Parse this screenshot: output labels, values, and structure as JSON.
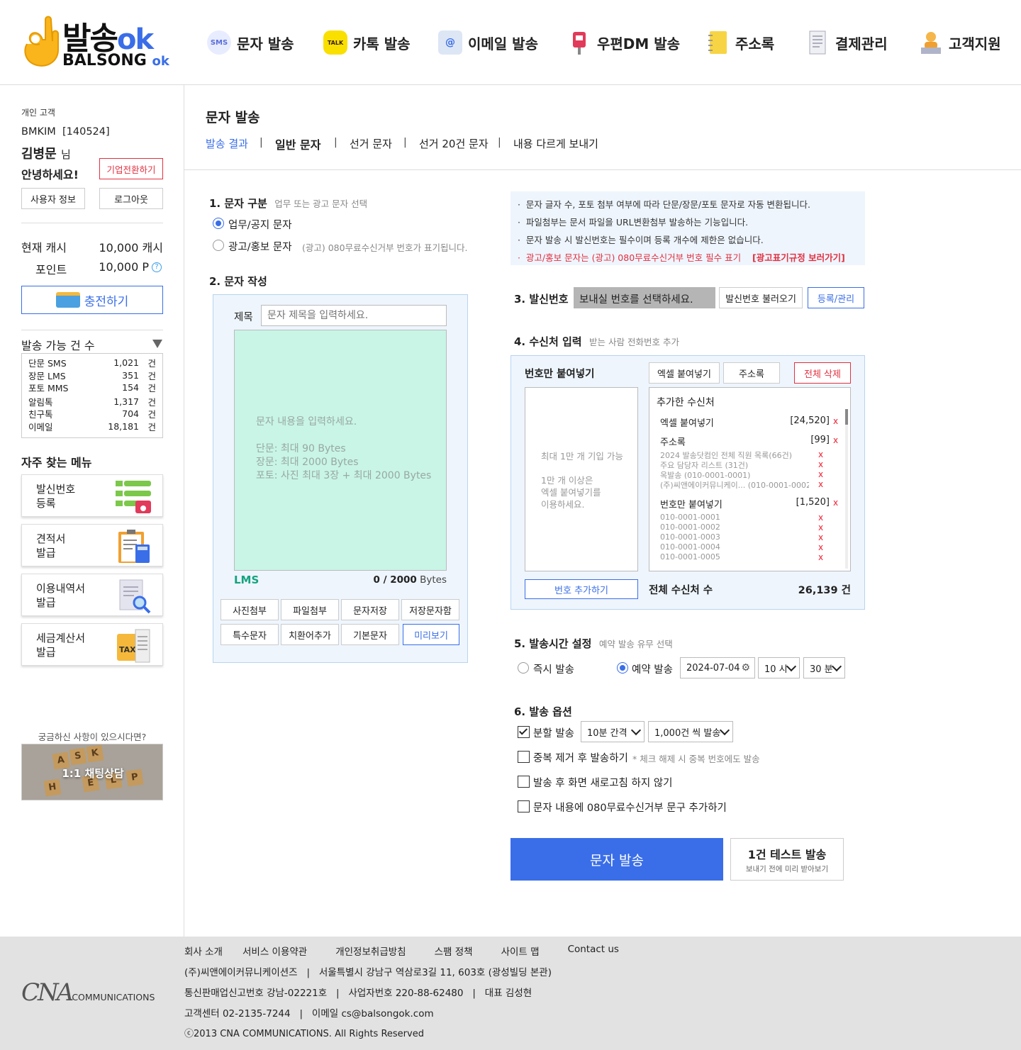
{
  "brand": {
    "logo_main": "발송",
    "logo_ok": "ok",
    "logo_sub": "BALSONG",
    "logo_sub_ok": "ok"
  },
  "nav": [
    {
      "label": "문자 발송",
      "icon": "sms-icon",
      "icon_text": "SMS"
    },
    {
      "label": "카톡 발송",
      "icon": "kakaotalk-icon",
      "icon_text": "TALK"
    },
    {
      "label": "이메일 발송",
      "icon": "email-icon",
      "icon_text": "@"
    },
    {
      "label": "우편DM 발송",
      "icon": "mailbox-icon",
      "icon_text": ""
    },
    {
      "label": "주소록",
      "icon": "address-book-icon",
      "icon_text": ""
    },
    {
      "label": "결제관리",
      "icon": "receipt-icon",
      "icon_text": ""
    },
    {
      "label": "고객지원",
      "icon": "support-agent-icon",
      "icon_text": ""
    }
  ],
  "sidebar": {
    "customer_type": "개인 고객",
    "user_id": "BMKIM",
    "user_code": "[140524]",
    "user_name": "김병문",
    "honorific": "님",
    "greeting": "안녕하세요!",
    "switch_corp": "기업전환하기",
    "user_info": "사용자 정보",
    "logout": "로그아웃",
    "cash_label": "현재 캐시",
    "cash_value": "10,000 캐시",
    "point_label": "포인트",
    "point_value": "10,000 P",
    "charge": "충전하기",
    "available_title": "발송 가능 건 수",
    "unit": "건",
    "counts": [
      {
        "name": "단문 SMS",
        "value": "1,021"
      },
      {
        "name": "장문 LMS",
        "value": "351"
      },
      {
        "name": "포토 MMS",
        "value": "154"
      },
      {
        "name": "알림톡",
        "value": "1,317"
      },
      {
        "name": "친구톡",
        "value": "704"
      },
      {
        "name": "이메일",
        "value": "18,181"
      }
    ],
    "fav_title": "자주 찾는 메뉴",
    "fav": [
      {
        "line1": "발신번호",
        "line2": "등록",
        "icon": "phone-register-icon"
      },
      {
        "line1": "견적서",
        "line2": "발급",
        "icon": "calculator-clipboard-icon"
      },
      {
        "line1": "이용내역서",
        "line2": "발급",
        "icon": "document-search-icon"
      },
      {
        "line1": "세금계산서",
        "line2": "발급",
        "icon": "tax-folder-icon"
      }
    ],
    "question": "궁금하신 사항이 있으시다면?",
    "chat": "1:1 채팅상담",
    "tiles": [
      "A",
      "S",
      "K",
      "H",
      "E",
      "L",
      "P"
    ]
  },
  "main": {
    "title": "문자 발송",
    "tabs": [
      "발송 결과",
      "일반 문자",
      "선거 문자",
      "선거 20건 문자",
      "내용 다르게 보내기"
    ],
    "sec1": {
      "title": "1. 문자 구분",
      "hint": "업무 또는 광고 문자 선택",
      "opt1": "업무/공지 문자",
      "opt2": "광고/홍보 문자",
      "opt2_hint": "(광고) 080무료수신거부 번호가 표기됩니다."
    },
    "sec2": {
      "title": "2. 문자 작성",
      "subject_label": "제목",
      "subject_placeholder": "문자 제목을 입력하세요.",
      "body_placeholder": "문자 내용을 입력하세요.",
      "limit_sms": "단문: 최대 90 Bytes",
      "limit_lms": "장문: 최대 2000 Bytes",
      "limit_mms": "포토: 사진 최대 3장 + 최대 2000 Bytes",
      "type": "LMS",
      "bytes_count": "0 / 2000",
      "bytes_unit": "Bytes",
      "buttons": [
        "사진첨부",
        "파일첨부",
        "문자저장",
        "저장문자함",
        "특수문자",
        "치환어추가",
        "기본문자",
        "미리보기"
      ]
    },
    "notices": [
      "문자 글자 수, 포토 첨부 여부에 따라 단문/장문/포토 문자로 자동 변환됩니다.",
      "파일첨부는 문서 파일을 URL변환첨부 발송하는 기능입니다.",
      "문자 발송 시 발신번호는 필수이며 등록 개수에 제한은 없습니다."
    ],
    "notice_warn": "광고/홍보 문자는 (광고) 080무료수신거부 번호 필수 표기",
    "notice_link": "[광고표기규정 보러가기]",
    "sec3": {
      "title": "3. 발신번호",
      "select": "보내실 번호를 선택하세요.",
      "load": "발신번호 불러오기",
      "register": "등록/관리"
    },
    "sec4": {
      "title": "4. 수신처 입력",
      "hint": "받는 사람 전화번호 추가",
      "paste_title": "번호만 붙여넣기",
      "excel": "엑셀 붙여넣기",
      "address": "주소록",
      "delete_all": "전체 삭제",
      "paste_hint1": "최대 1만 개 기입 가능",
      "paste_hint2": "1만 개 이상은",
      "paste_hint3": "엑셀 붙여넣기를",
      "paste_hint4": "이용하세요.",
      "added_title": "추가한 수신처",
      "excel_label": "엑셀 붙여넣기",
      "excel_count": "[24,520]",
      "addr_label": "주소록",
      "addr_count": "[99]",
      "addr_items": [
        "2024 발송닷컴인 전체 직원 목록(66건)",
        "주요 담당자 리스트 (31건)",
        "옥발송 (010-0001-0001)",
        "(주)씨앤에이커뮤니케이... (010-0001-0002)"
      ],
      "num_label": "번호만 붙여넣기",
      "num_count": "[1,520]",
      "num_items": [
        "010-0001-0001",
        "010-0001-0002",
        "010-0001-0003",
        "010-0001-0004",
        "010-0001-0005"
      ],
      "x": "x",
      "add_number": "번호 추가하기",
      "total_label": "전체 수신처 수",
      "total_value": "26,139 건"
    },
    "sec5": {
      "title": "5. 발송시간 설정",
      "hint": "예약 발송 유무 선택",
      "now": "즉시 발송",
      "reserve": "예약 발송",
      "date": "2024-07-04",
      "hour": "10 시",
      "minute": "30 분"
    },
    "sec6": {
      "title": "6. 발송 옵션",
      "split": "분할 발송",
      "interval": "10분 간격",
      "batch": "1,000건 씩 발송",
      "dedupe": "중복 제거 후 발송하기",
      "dedupe_hint": "* 체크 해제 시 중복 번호에도 발송",
      "no_refresh": "발송 후 화면 새로고침 하지 않기",
      "add_080": "문자 내용에 080무료수신거부 문구 추가하기"
    },
    "send": "문자 발송",
    "test_send": "1건 테스트 발송",
    "test_hint": "보내기 전에 미리 받아보기"
  },
  "footer": {
    "links": [
      "회사 소개",
      "서비스 이용약관",
      "개인정보취급방침",
      "스팸 정책",
      "사이트 맵",
      "Contact us"
    ],
    "company": "(주)씨앤에이커뮤니케이션즈",
    "address": "서울특별시 강남구 역삼로3길 11, 603호 (광성빌딩 본관)",
    "sales_reg": "통신판매업신고번호 강남-02221호",
    "biz_reg": "사업자번호 220-88-62480",
    "ceo": "대표 김성현",
    "cs": "고객센터 02-2135-7244",
    "email": "이메일 cs@balsongok.com",
    "copyright": "ⓒ2013 CNA COMMUNICATIONS. All Rights Reserved",
    "logo_script": "CNA",
    "logo_word": "COMMUNICATIONS"
  },
  "colors": {
    "accent": "#3a6ee8",
    "warn": "#e23040",
    "mint": "#c8f5e6",
    "panel": "#eef5fd"
  }
}
